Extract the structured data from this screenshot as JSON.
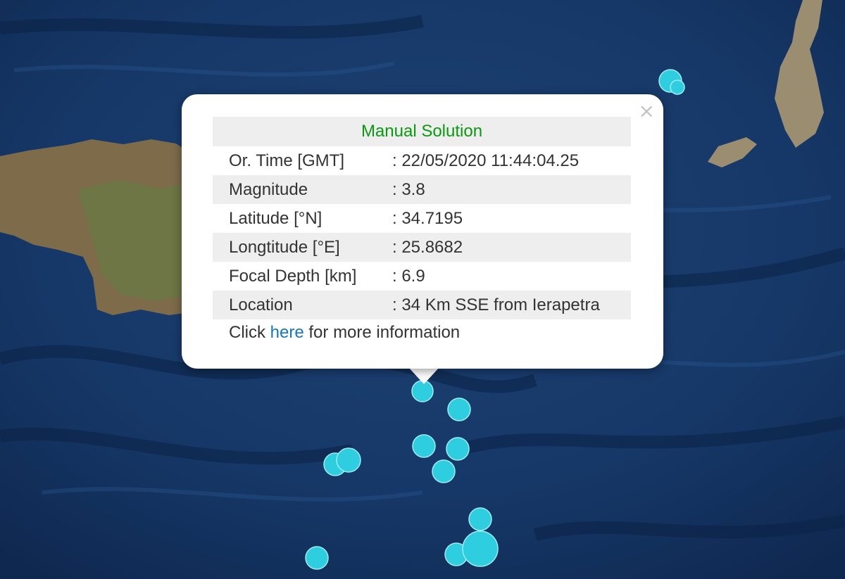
{
  "popup": {
    "header": "Manual Solution",
    "rows": [
      {
        "label": "Or. Time [GMT]",
        "value": ": 22/05/2020 11:44:04.25"
      },
      {
        "label": "Magnitude",
        "value": ": 3.8"
      },
      {
        "label": "Latitude [°N]",
        "value": ": 34.7195"
      },
      {
        "label": "Longtitude [°E]",
        "value": ": 25.8682"
      },
      {
        "label": "Focal Depth [km]",
        "value": ": 6.9"
      },
      {
        "label": "Location",
        "value": ": 34 Km SSE from Ierapetra"
      }
    ],
    "info_prefix": "Click",
    "info_link": "here",
    "info_suffix": "for more information",
    "close_symbol": "×"
  },
  "colors": {
    "sea": "#132f5a",
    "land": "#7d6b4a",
    "marker": "#2fcde0",
    "header_text": "#0a9a10",
    "link": "#1976b8"
  }
}
